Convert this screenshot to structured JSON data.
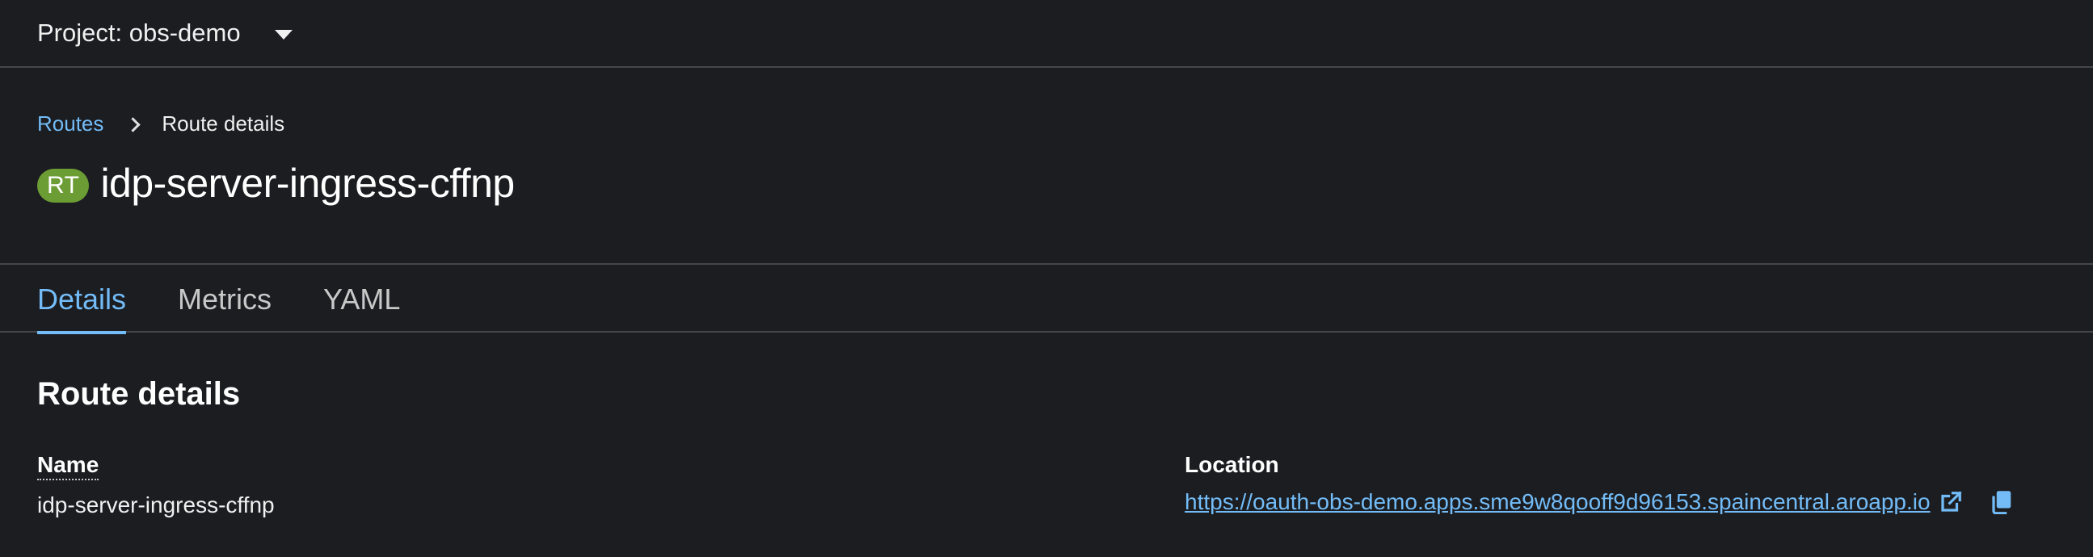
{
  "project_bar": {
    "label": "Project: obs-demo",
    "caret_icon": "caret-down-icon"
  },
  "breadcrumb": {
    "parent": "Routes",
    "current": "Route details"
  },
  "header": {
    "badge": "RT",
    "badge_color": "#6c9d34",
    "title": "idp-server-ingress-cffnp"
  },
  "tabs": [
    {
      "label": "Details",
      "active": true
    },
    {
      "label": "Metrics",
      "active": false
    },
    {
      "label": "YAML",
      "active": false
    }
  ],
  "section": {
    "title": "Route details"
  },
  "fields": {
    "name_label": "Name",
    "name_value": "idp-server-ingress-cffnp",
    "location_label": "Location",
    "location_value": "https://oauth-obs-demo.apps.sme9w8qooff9d96153.spaincentral.aroapp.io"
  },
  "icons": {
    "external_link": "external-link-icon",
    "copy": "copy-icon"
  },
  "colors": {
    "accent": "#73bcf7",
    "background": "#1b1d21",
    "border": "#44464b"
  }
}
